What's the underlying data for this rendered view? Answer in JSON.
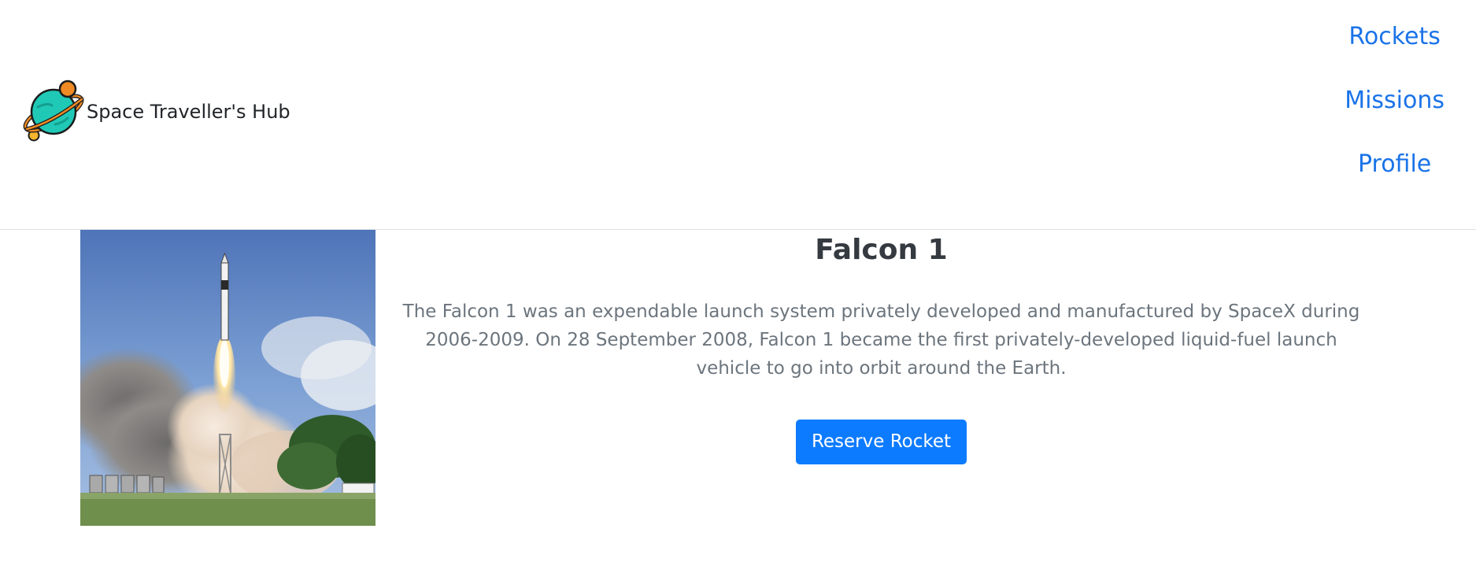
{
  "header": {
    "brand_title": "Space Traveller's Hub",
    "logo_icon": "planet-icon",
    "nav": [
      {
        "label": "Rockets"
      },
      {
        "label": "Missions"
      },
      {
        "label": "Profile"
      }
    ]
  },
  "rocket": {
    "name": "Falcon 1",
    "description": "The Falcon 1 was an expendable launch system privately developed and manufactured by SpaceX during 2006-2009. On 28 September 2008, Falcon 1 became the first privately-developed liquid-fuel launch vehicle to go into orbit around the Earth.",
    "button_label": "Reserve Rocket",
    "image_icon": "rocket-launch-image"
  },
  "colors": {
    "link": "#1a73e8",
    "button": "#0d7bff",
    "text_muted": "#6c757d",
    "planet": "#1fc9b6",
    "moon": "#f08a24"
  }
}
